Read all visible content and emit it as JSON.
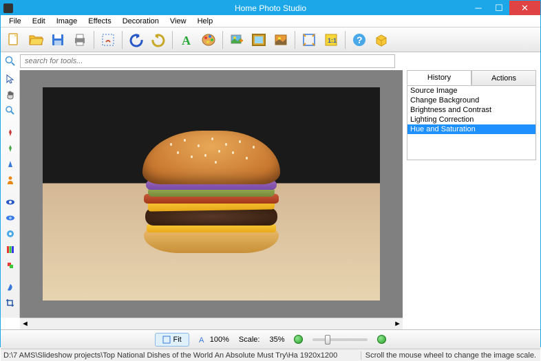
{
  "title": "Home Photo Studio",
  "menu": [
    "File",
    "Edit",
    "Image",
    "Effects",
    "Decoration",
    "View",
    "Help"
  ],
  "search": {
    "placeholder": "search for tools..."
  },
  "tabs": {
    "history": "History",
    "actions": "Actions"
  },
  "history_items": [
    "Source Image",
    "Change Background",
    "Brightness and Contrast",
    "Lighting Correction",
    "Hue and Saturation"
  ],
  "history_selected": 4,
  "bottom": {
    "fit": "Fit",
    "pct": "100%",
    "scale_label": "Scale:",
    "scale_value": "35%"
  },
  "status": {
    "left": "D:\\7 AMS\\Slideshow projects\\Top  National Dishes of the World  An Absolute Must Try\\Ha  1920x1200",
    "right": "Scroll the mouse wheel to change the image scale."
  },
  "toolbar_icons": [
    "new-file",
    "open-folder",
    "save",
    "print",
    "cut-region",
    "undo",
    "redo",
    "text",
    "color-palette",
    "insert-image",
    "frame",
    "picture-effect",
    "fit-screen",
    "actual-size",
    "help",
    "package"
  ],
  "vtool_icons": [
    "pointer",
    "hand",
    "zoom",
    "red-brush",
    "green-brush",
    "blue-cone",
    "orange-person",
    "eye-blue1",
    "eye-blue2",
    "eye-bright",
    "color-bars",
    "clone-stamp",
    "smudge",
    "crop"
  ]
}
